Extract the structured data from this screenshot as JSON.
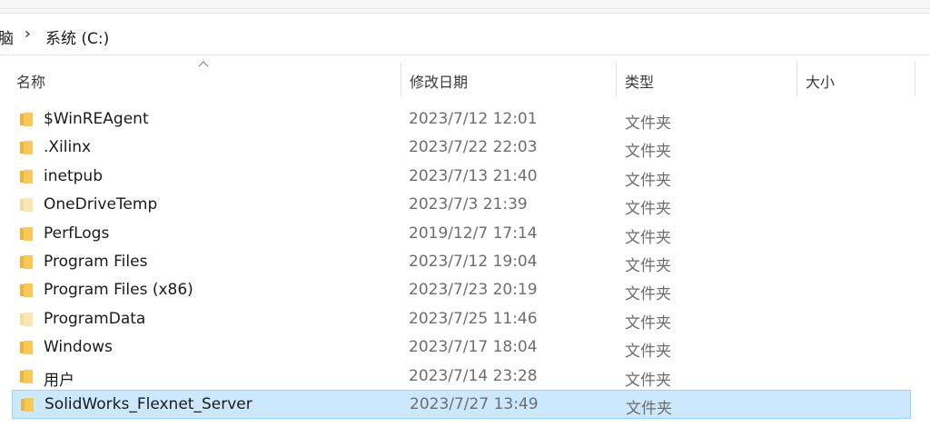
{
  "breadcrumb": {
    "items": [
      "脑",
      "系统 (C:)"
    ]
  },
  "columns": {
    "name": "名称",
    "date": "修改日期",
    "type": "类型",
    "size": "大小"
  },
  "colors": {
    "selection_bg": "#cce8ff",
    "selection_border": "#99d1ff",
    "folder": "#f8c95a"
  },
  "files": [
    {
      "name": "$WinREAgent",
      "date": "2023/7/12 12:01",
      "type": "文件夹",
      "icon": "folder-icon"
    },
    {
      "name": ".Xilinx",
      "date": "2023/7/22 22:03",
      "type": "文件夹",
      "icon": "folder-icon"
    },
    {
      "name": "inetpub",
      "date": "2023/7/13 21:40",
      "type": "文件夹",
      "icon": "folder-icon"
    },
    {
      "name": "OneDriveTemp",
      "date": "2023/7/3 21:39",
      "type": "文件夹",
      "icon": "folder-icon-faded"
    },
    {
      "name": "PerfLogs",
      "date": "2019/12/7 17:14",
      "type": "文件夹",
      "icon": "folder-icon"
    },
    {
      "name": "Program Files",
      "date": "2023/7/12 19:04",
      "type": "文件夹",
      "icon": "folder-icon"
    },
    {
      "name": "Program Files (x86)",
      "date": "2023/7/23 20:19",
      "type": "文件夹",
      "icon": "folder-icon"
    },
    {
      "name": "ProgramData",
      "date": "2023/7/25 11:46",
      "type": "文件夹",
      "icon": "folder-icon-faded"
    },
    {
      "name": "Windows",
      "date": "2023/7/17 18:04",
      "type": "文件夹",
      "icon": "folder-icon"
    },
    {
      "name": "用户",
      "date": "2023/7/14 23:28",
      "type": "文件夹",
      "icon": "folder-icon"
    },
    {
      "name": "SolidWorks_Flexnet_Server",
      "date": "2023/7/27 13:49",
      "type": "文件夹",
      "icon": "folder-icon",
      "selected": true
    }
  ]
}
